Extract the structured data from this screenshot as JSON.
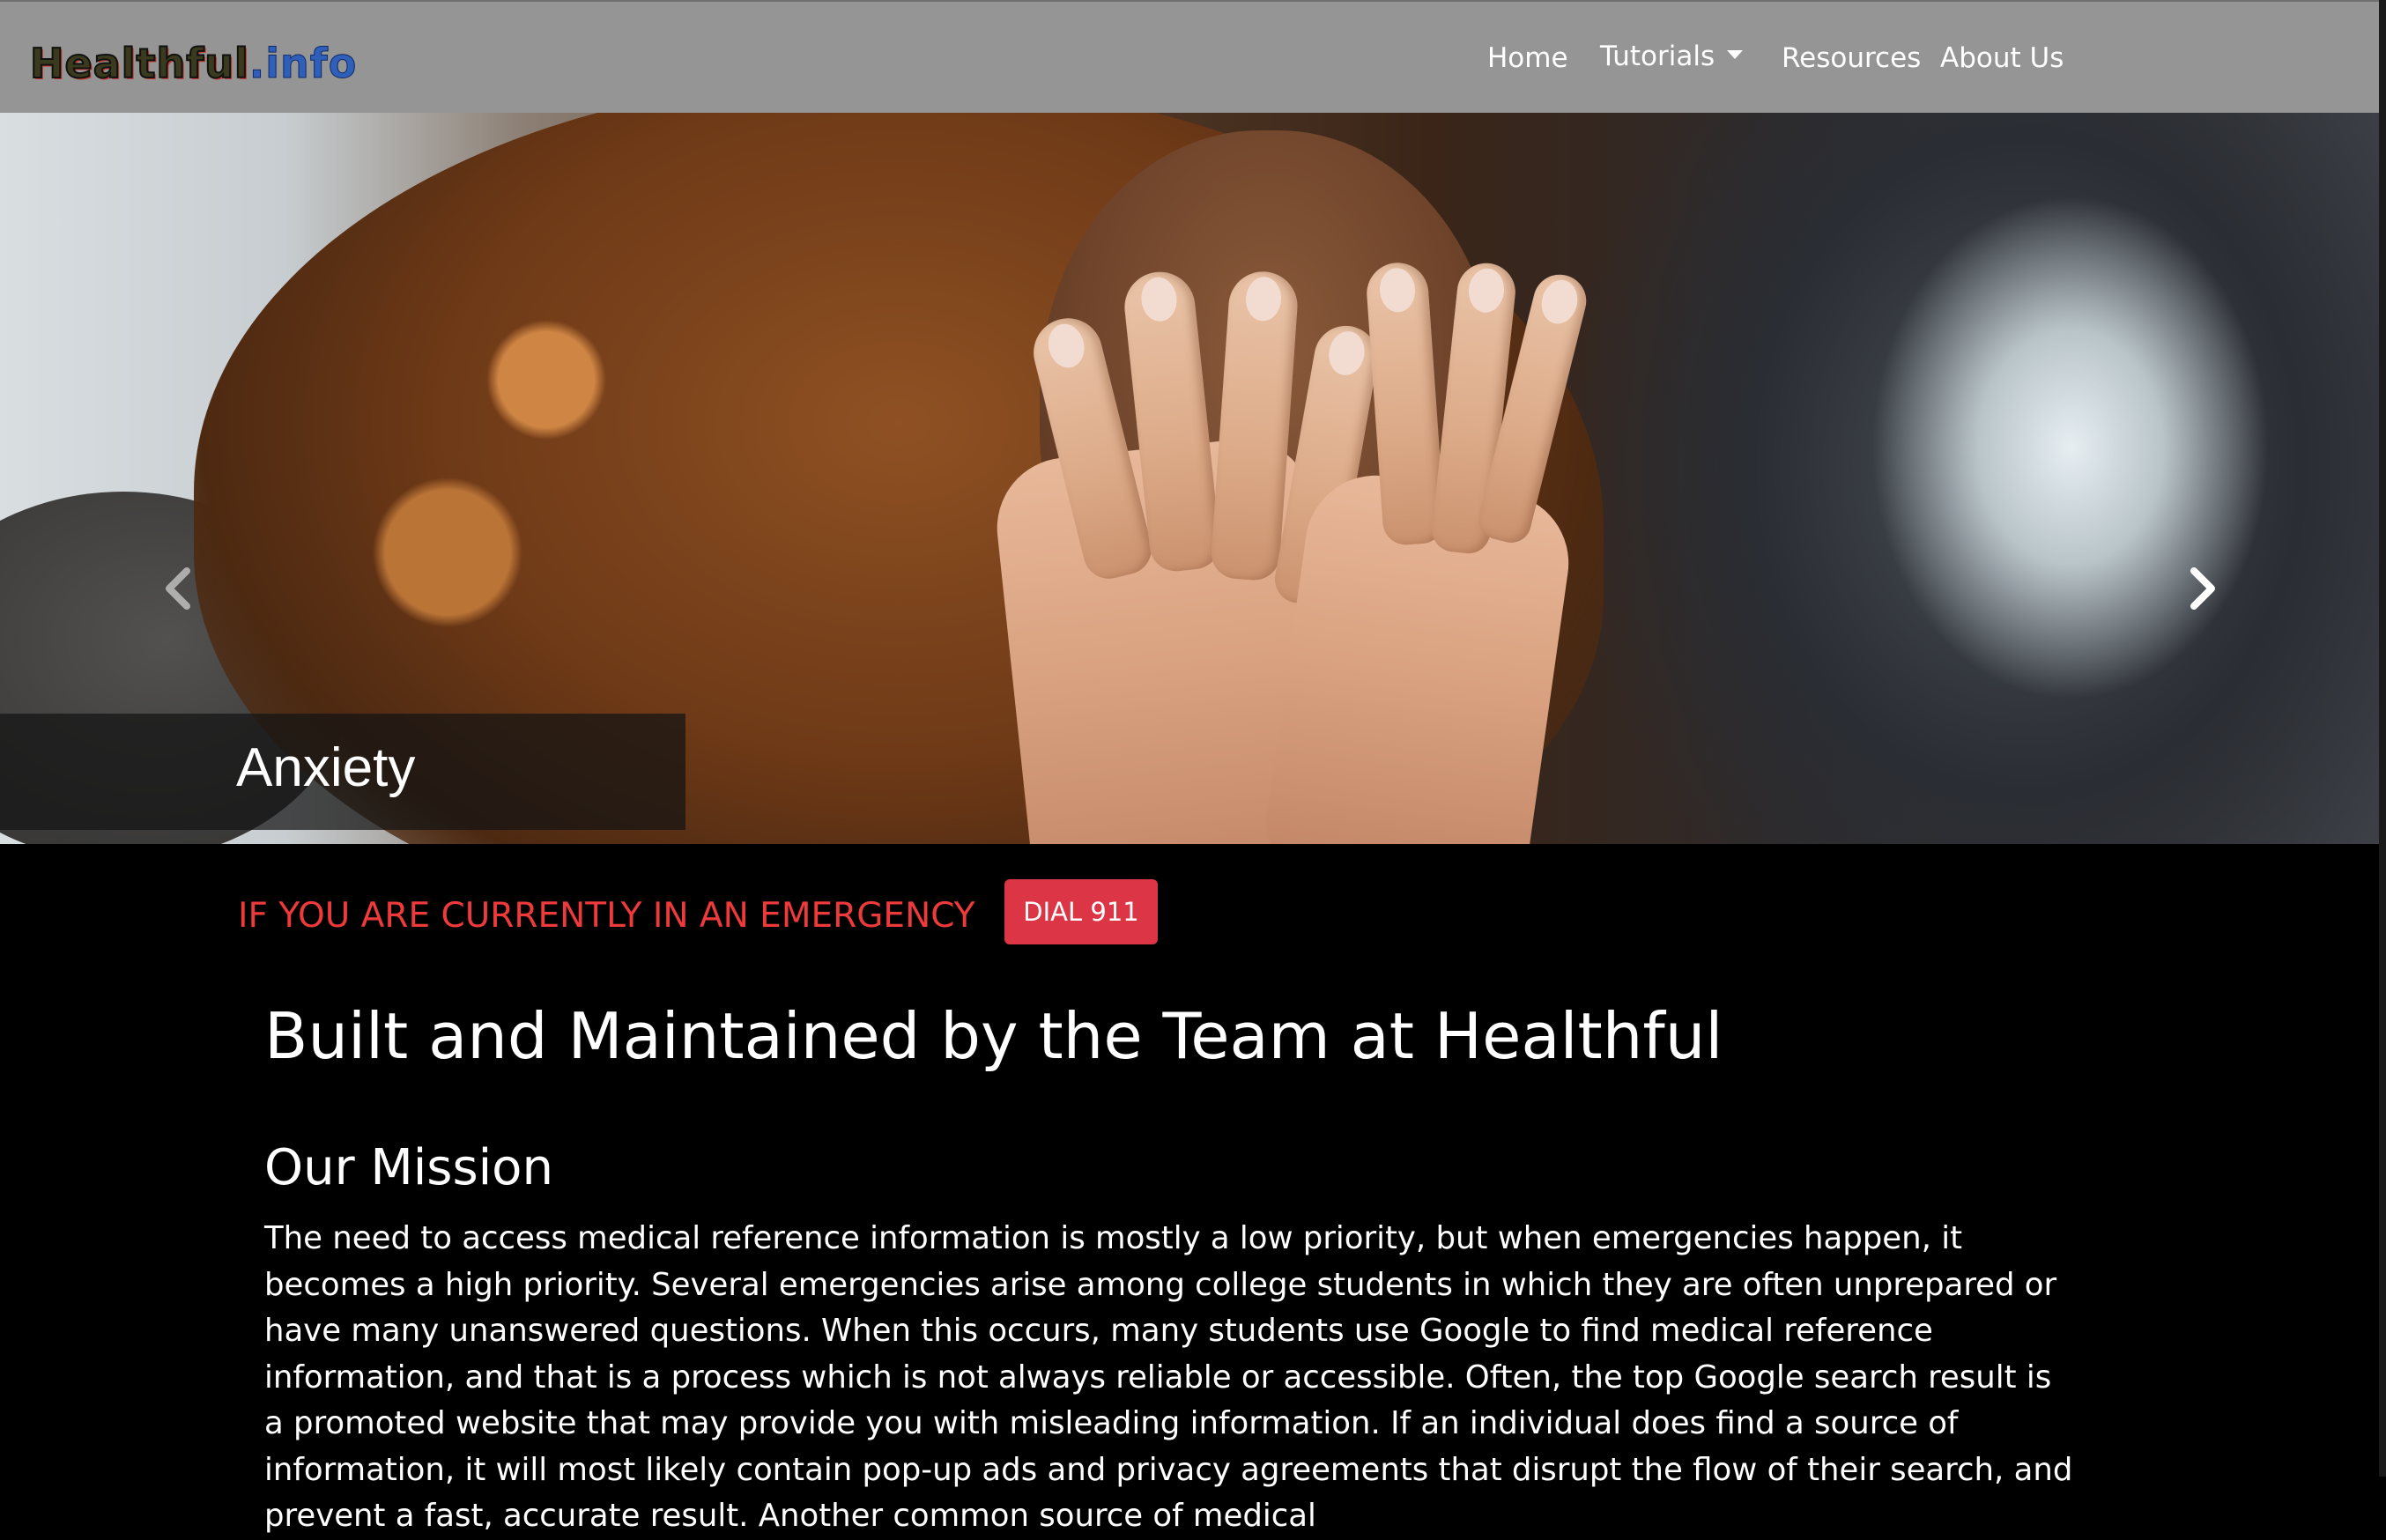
{
  "navbar": {
    "brand_part1": "Healthful",
    "brand_part2": ".info",
    "links": [
      {
        "label": "Home"
      },
      {
        "label": "Tutorials"
      },
      {
        "label": "Resources"
      },
      {
        "label": "About Us"
      }
    ]
  },
  "carousel": {
    "caption": "Anxiety",
    "prev_icon": "chevron-left-icon",
    "next_icon": "chevron-right-icon",
    "slides_count": 3,
    "active_slide": 3
  },
  "emergency": {
    "message": "IF YOU ARE CURRENTLY IN AN EMERGENCY",
    "button_label": "DIAL 911",
    "message_color": "#ee3a3a",
    "button_color": "#dc3545"
  },
  "main": {
    "title": "Built and Maintained by the Team at Healthful",
    "mission_heading": "Our Mission",
    "mission_text": "The need to access medical reference information is mostly a low priority, but when emergencies happen, it becomes a high priority. Several emergencies arise among college students in which they are often unprepared or have many unanswered questions. When this occurs, many students use Google to find medical reference information, and that is a process which is not always reliable or accessible. Often, the top Google search result is a promoted website that may provide you with misleading information. If an individual does find a source of information, it will most likely contain pop-up ads and privacy agreements that disrupt the flow of their search, and prevent a fast, accurate result. Another common source of medical"
  },
  "colors": {
    "navbar_bg": "#959595",
    "page_bg": "#000000"
  }
}
